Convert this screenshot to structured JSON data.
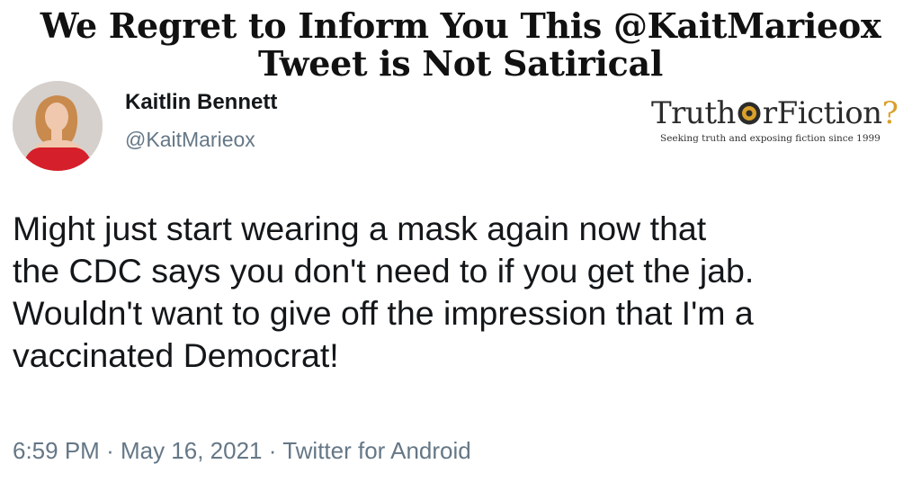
{
  "headline": {
    "line1": "We Regret to Inform You This @KaitMarieox",
    "line2": "Tweet is Not Satirical"
  },
  "tweet": {
    "display_name": "Kaitlin Bennett",
    "handle": "@KaitMarieox",
    "text_lines": [
      "Might just start wearing a mask again now that",
      "the CDC says you don't need to if you get the jab.",
      "Wouldn't want to give off the impression that I'm a",
      "vaccinated Democrat!"
    ],
    "time": "6:59 PM",
    "date": "May 16, 2021",
    "source": "Twitter for Android",
    "separator": "·"
  },
  "logo": {
    "part1": "Truth",
    "part2": "rFiction",
    "part3": "?",
    "tagline": "Seeking truth and exposing fiction since 1999",
    "accent_color": "#d9a02a",
    "icon": "target-eye-icon"
  }
}
